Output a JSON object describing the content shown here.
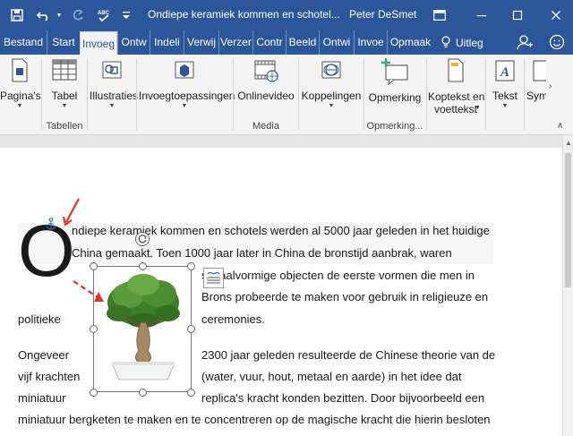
{
  "title_bar": {
    "document_title": "Ondiepe keramiek kommen en schotel...",
    "user_name": "Peter DeSmet",
    "save_icon": "save-icon",
    "undo_icon": "undo-icon",
    "redo_icon": "redo-icon",
    "spelling_icon": "spelling-check-icon",
    "customize_icon": "customize-toolbar-icon",
    "options_icon": "ribbon-display-options-icon",
    "minimize_icon": "minimize-icon",
    "restore_icon": "restore-icon",
    "close_icon": "close-icon"
  },
  "tabs": [
    {
      "label": "Bestand"
    },
    {
      "label": "Start"
    },
    {
      "label": "Invoeg"
    },
    {
      "label": "Ontw"
    },
    {
      "label": "Indeli"
    },
    {
      "label": "Verwij"
    },
    {
      "label": "Verzer"
    },
    {
      "label": "Contr"
    },
    {
      "label": "Beeld"
    },
    {
      "label": "Ontwi"
    },
    {
      "label": "Invoe"
    },
    {
      "label": "Opmaak"
    }
  ],
  "active_tab": "Invoeg",
  "tell_me": {
    "label": "Uitleg",
    "icon": "lightbulb-icon"
  },
  "account_icon": "share-person-icon",
  "emoji_icon": "smiley-feedback-icon",
  "ribbon": {
    "pages": {
      "label": "Pagina's",
      "icon": "page-icon"
    },
    "table": {
      "label": "Tabel",
      "icon": "table-icon"
    },
    "tables_group": "Tabellen",
    "illustrations": {
      "label": "Illustraties",
      "icon": "shapes-icon"
    },
    "addins": {
      "label": "Invoegtoepassingen",
      "icon": "store-icon"
    },
    "online_video": {
      "label": "Onlinevideo",
      "icon": "video-icon"
    },
    "media_group": "Media",
    "links": {
      "label": "Koppelingen",
      "icon": "link-icon"
    },
    "comment": {
      "label": "Opmerking",
      "icon": "comment-icon"
    },
    "comments_group": "Opmerking...",
    "header_footer": {
      "label": "Koptekst en",
      "label2": "voettekst",
      "icon": "header-footer-icon"
    },
    "text": {
      "label": "Tekst",
      "icon": "text-icon"
    },
    "symbols": {
      "label": "Sym",
      "icon": "symbol-icon"
    },
    "collapse_icon": "collapse-ribbon-icon"
  },
  "document": {
    "drop_cap": "O",
    "lines": [
      "ndiepe keramiek kommen en schotels werden al 5000 jaar geleden in het huidige",
      "China gemaakt. Toen 1000 jaar later in China de bronstijd aanbrak, waren",
      "schaalvormige objecten de eerste vormen die men in",
      "Brons probeerde te maken voor gebruik in religieuze en",
      "politieke",
      "ceremonies.",
      "Ongeveer",
      "2300 jaar geleden resulteerde de Chinese theorie van de",
      "vijf krachten",
      "(water, vuur, hout, metaal en aarde) in het idee dat",
      "miniatuur",
      "replica's kracht konden bezitten. Door bijvoorbeeld een",
      "miniatuur bergketen te maken en te concentreren op de magische kracht die hierin besloten"
    ],
    "image_icon": "bonsai-tree-image",
    "rotate_icon": "rotate-handle-icon",
    "layout_options_icon": "layout-options-icon",
    "anchor_icon": "anchor-icon",
    "annotation_color": "#e8302a"
  },
  "colors": {
    "accent": "#2b579a",
    "ribbon_bg": "#f3f3f3"
  }
}
